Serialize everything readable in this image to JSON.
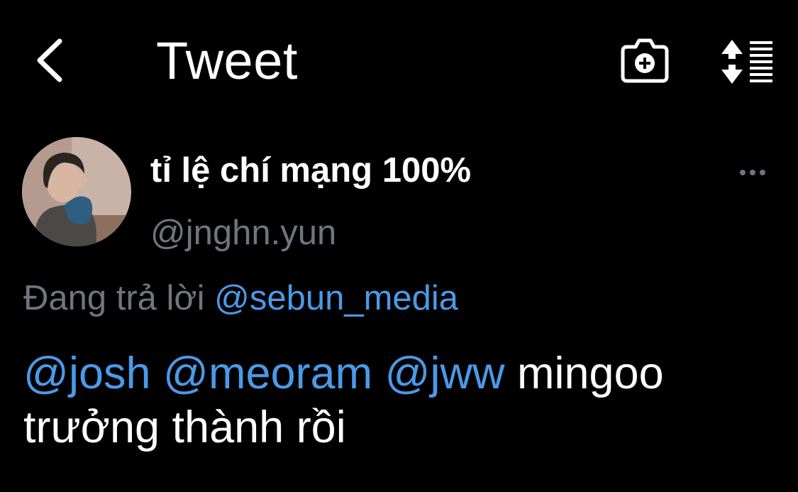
{
  "header": {
    "title": "Tweet",
    "back_icon": "chevron-left-icon",
    "camera_icon": "camera-add-icon",
    "sort_icon": "sort-lines-icon"
  },
  "tweet": {
    "author": {
      "display_name": "tỉ lệ chí mạng 100%",
      "handle": "@jnghn.yun"
    },
    "more_icon": "more-horizontal-icon",
    "reply": {
      "prefix": "Đang trả lời",
      "to": "@sebun_media"
    },
    "mentions": [
      "@josh",
      "@meoram",
      "@jww"
    ],
    "text_line1_rest": "mingoo",
    "text_line2": "trưởng thành rồi"
  },
  "colors": {
    "background": "#000000",
    "text": "#ffffff",
    "secondary_text": "#6e767d",
    "link": "#4a9ae8"
  }
}
